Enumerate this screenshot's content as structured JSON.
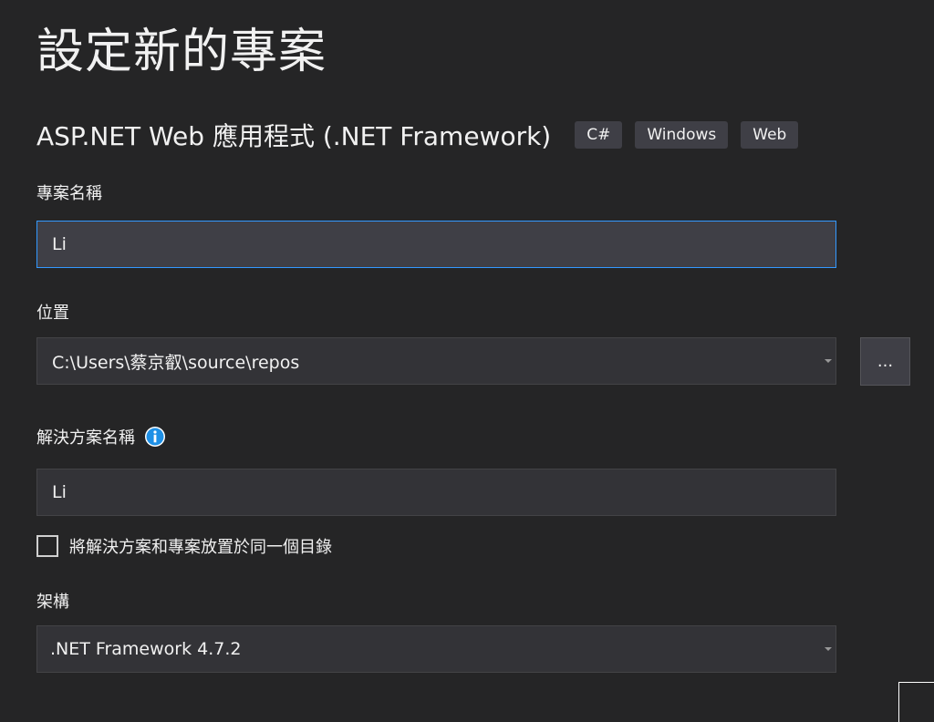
{
  "page_title": "設定新的專案",
  "template": {
    "name": "ASP.NET Web 應用程式 (.NET Framework)",
    "tags": [
      "C#",
      "Windows",
      "Web"
    ]
  },
  "project_name": {
    "label": "專案名稱",
    "value": "Li"
  },
  "location": {
    "label": "位置",
    "value": "C:\\Users\\蔡京叡\\source\\repos",
    "browse_label": "..."
  },
  "solution_name": {
    "label": "解決方案名稱",
    "value": "Li",
    "info_icon": "info-icon"
  },
  "same_directory": {
    "label": "將解決方案和專案放置於同一個目錄",
    "checked": false
  },
  "framework": {
    "label": "架構",
    "value": ".NET Framework 4.7.2"
  },
  "colors": {
    "background": "#252526",
    "field": "#333337",
    "focus_border": "#3399ff",
    "info_icon": "#1e90e6",
    "tag": "#3f3f46"
  }
}
